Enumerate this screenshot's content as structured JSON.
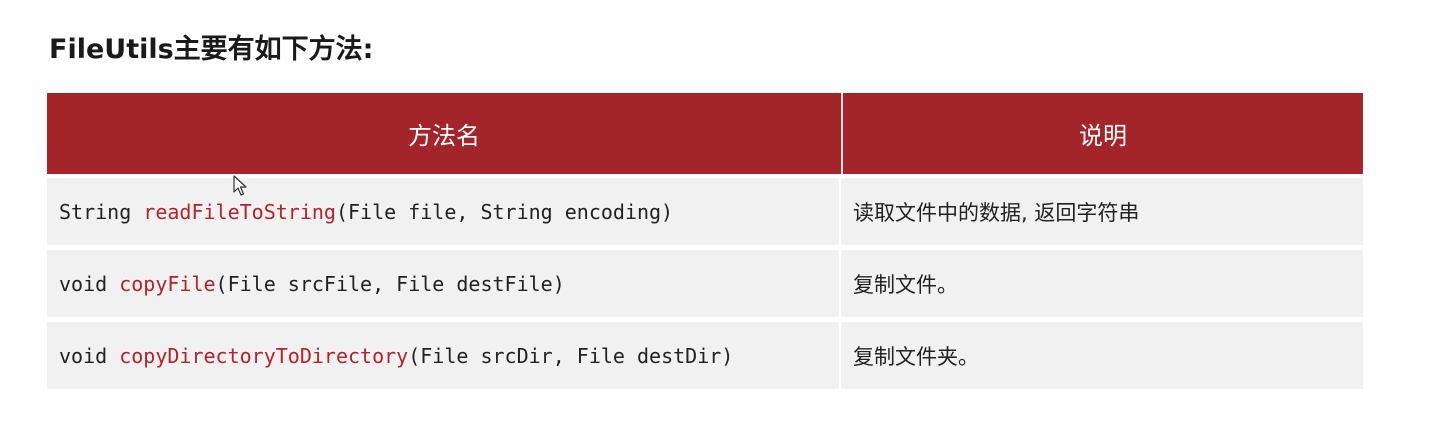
{
  "title": "FileUtils主要有如下方法:",
  "table": {
    "headers": [
      "方法名",
      "说明"
    ],
    "rows": [
      {
        "prefix": "String ",
        "method": "readFileToString",
        "params": "(File file, String encoding)",
        "description": "读取文件中的数据, 返回字符串"
      },
      {
        "prefix": "void ",
        "method": "copyFile",
        "params": "(File srcFile, File destFile)",
        "description": "复制文件。"
      },
      {
        "prefix": "void ",
        "method": "copyDirectoryToDirectory",
        "params": "(File srcDir, File destDir)",
        "description": "复制文件夹。"
      }
    ]
  },
  "colors": {
    "header_bg": "#a3252a",
    "method_text": "#b0242b",
    "row_bg": "#f1f1f1"
  }
}
